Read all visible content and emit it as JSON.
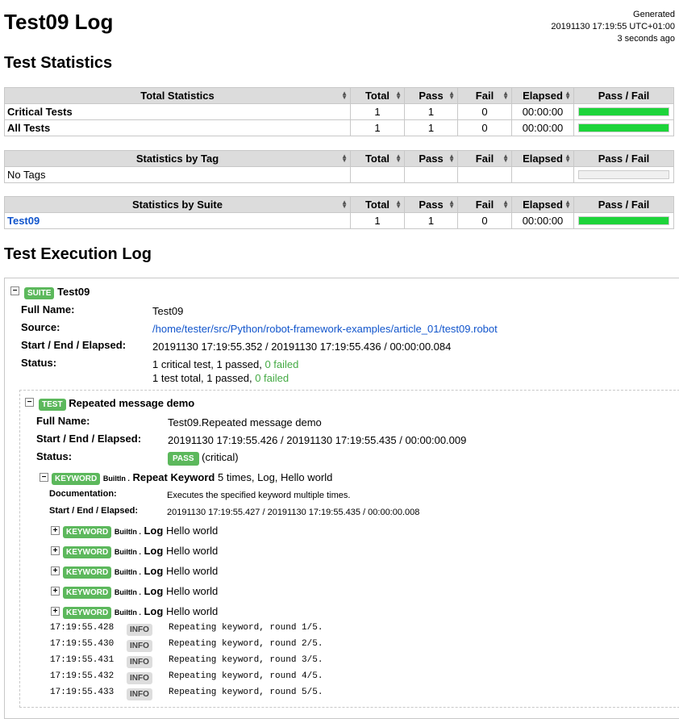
{
  "header": {
    "title": "Test09 Log",
    "generated_label": "Generated",
    "generated_time": "20191130 17:19:55 UTC+01:00",
    "generated_ago": "3 seconds ago"
  },
  "sections": {
    "stats_title": "Test Statistics",
    "log_title": "Test Execution Log"
  },
  "columns": {
    "total": "Total",
    "pass": "Pass",
    "fail": "Fail",
    "elapsed": "Elapsed",
    "passfail": "Pass / Fail"
  },
  "total_stats": {
    "header": "Total Statistics",
    "rows": [
      {
        "name": "Critical Tests",
        "total": "1",
        "pass": "1",
        "fail": "0",
        "elapsed": "00:00:00",
        "pass_ratio": 1.0
      },
      {
        "name": "All Tests",
        "total": "1",
        "pass": "1",
        "fail": "0",
        "elapsed": "00:00:00",
        "pass_ratio": 1.0
      }
    ]
  },
  "tag_stats": {
    "header": "Statistics by Tag",
    "rows": [
      {
        "name": "No Tags",
        "total": "",
        "pass": "",
        "fail": "",
        "elapsed": "",
        "pass_ratio": 0
      }
    ]
  },
  "suite_stats": {
    "header": "Statistics by Suite",
    "rows": [
      {
        "name": "Test09",
        "total": "1",
        "pass": "1",
        "fail": "0",
        "elapsed": "00:00:00",
        "pass_ratio": 1.0
      }
    ]
  },
  "suite": {
    "badge": "SUITE",
    "name": "Test09",
    "full_name_label": "Full Name:",
    "full_name": "Test09",
    "source_label": "Source:",
    "source": "/home/tester/src/Python/robot-framework-examples/article_01/test09.robot",
    "times_label": "Start / End / Elapsed:",
    "times": "20191130 17:19:55.352 / 20191130 17:19:55.436 / 00:00:00.084",
    "status_label": "Status:",
    "status_line1_prefix": "1 critical test, 1 passed, ",
    "status_line1_failed": "0 failed",
    "status_line2_prefix": "1 test total, 1 passed, ",
    "status_line2_failed": "0 failed"
  },
  "test": {
    "badge": "TEST",
    "name": "Repeated message demo",
    "full_name_label": "Full Name:",
    "full_name": "Test09.Repeated message demo",
    "times_label": "Start / End / Elapsed:",
    "times": "20191130 17:19:55.426 / 20191130 17:19:55.435 / 00:00:00.009",
    "status_label": "Status:",
    "status_badge": "PASS",
    "status_note": "(critical)"
  },
  "keyword": {
    "badge": "KEYWORD",
    "lib": "BuiltIn .",
    "name": "Repeat Keyword",
    "args": "5 times, Log, Hello world",
    "doc_label": "Documentation:",
    "doc": "Executes the specified keyword multiple times.",
    "times_label": "Start / End / Elapsed:",
    "times": "20191130 17:19:55.427 / 20191130 17:19:55.435 / 00:00:00.008",
    "children": [
      {
        "badge": "KEYWORD",
        "lib": "BuiltIn .",
        "name": "Log",
        "args": "Hello world"
      },
      {
        "badge": "KEYWORD",
        "lib": "BuiltIn .",
        "name": "Log",
        "args": "Hello world"
      },
      {
        "badge": "KEYWORD",
        "lib": "BuiltIn .",
        "name": "Log",
        "args": "Hello world"
      },
      {
        "badge": "KEYWORD",
        "lib": "BuiltIn .",
        "name": "Log",
        "args": "Hello world"
      },
      {
        "badge": "KEYWORD",
        "lib": "BuiltIn .",
        "name": "Log",
        "args": "Hello world"
      }
    ],
    "messages": [
      {
        "time": "17:19:55.428",
        "level": "INFO",
        "text": "Repeating keyword, round 1/5."
      },
      {
        "time": "17:19:55.430",
        "level": "INFO",
        "text": "Repeating keyword, round 2/5."
      },
      {
        "time": "17:19:55.431",
        "level": "INFO",
        "text": "Repeating keyword, round 3/5."
      },
      {
        "time": "17:19:55.432",
        "level": "INFO",
        "text": "Repeating keyword, round 4/5."
      },
      {
        "time": "17:19:55.433",
        "level": "INFO",
        "text": "Repeating keyword, round 5/5."
      }
    ]
  },
  "toggles": {
    "expanded": "−",
    "collapsed": "+"
  },
  "icons": {
    "sort": "sort-arrows-icon",
    "expand": "plus-icon",
    "collapse": "minus-icon"
  },
  "colors": {
    "pass_bar": "#1dd43a",
    "badge": "#5cb85c",
    "link": "#1155cc"
  }
}
